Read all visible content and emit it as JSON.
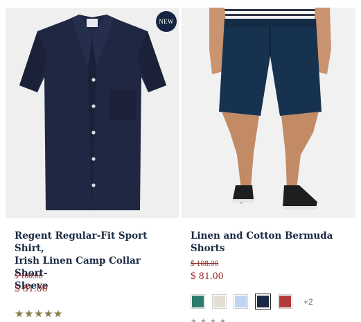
{
  "products": [
    {
      "badge": "NEW",
      "title_lines": [
        "Regent Regular-Fit Sport Shirt,",
        "Irish Linen Camp Collar Short-",
        "Sleeve"
      ],
      "price_original": "$ 108.00",
      "price_sale": "$ 81.00",
      "rating_stars": 5,
      "star_glyph": "★",
      "image_icon": "navy-camp-collar-shirt-photo",
      "colors": {
        "fabric": "#1f2743",
        "accent": "#142441"
      }
    },
    {
      "title_lines": [
        "Linen and Cotton Bermuda",
        "Shorts"
      ],
      "price_original": "$ 108.00",
      "price_sale": "$ 81.00",
      "star_glyph": "★",
      "image_icon": "model-wearing-navy-shorts-photo",
      "swatches": [
        {
          "name": "teal",
          "color": "#2d7a6e",
          "selected": false
        },
        {
          "name": "natural",
          "color": "#e5dfd3",
          "selected": false
        },
        {
          "name": "light-blue",
          "color": "#bcd6f2",
          "selected": false
        },
        {
          "name": "navy",
          "color": "#1b2a44",
          "selected": true
        },
        {
          "name": "red",
          "color": "#b23b3b",
          "selected": false
        }
      ],
      "more_colors": "+2"
    }
  ]
}
